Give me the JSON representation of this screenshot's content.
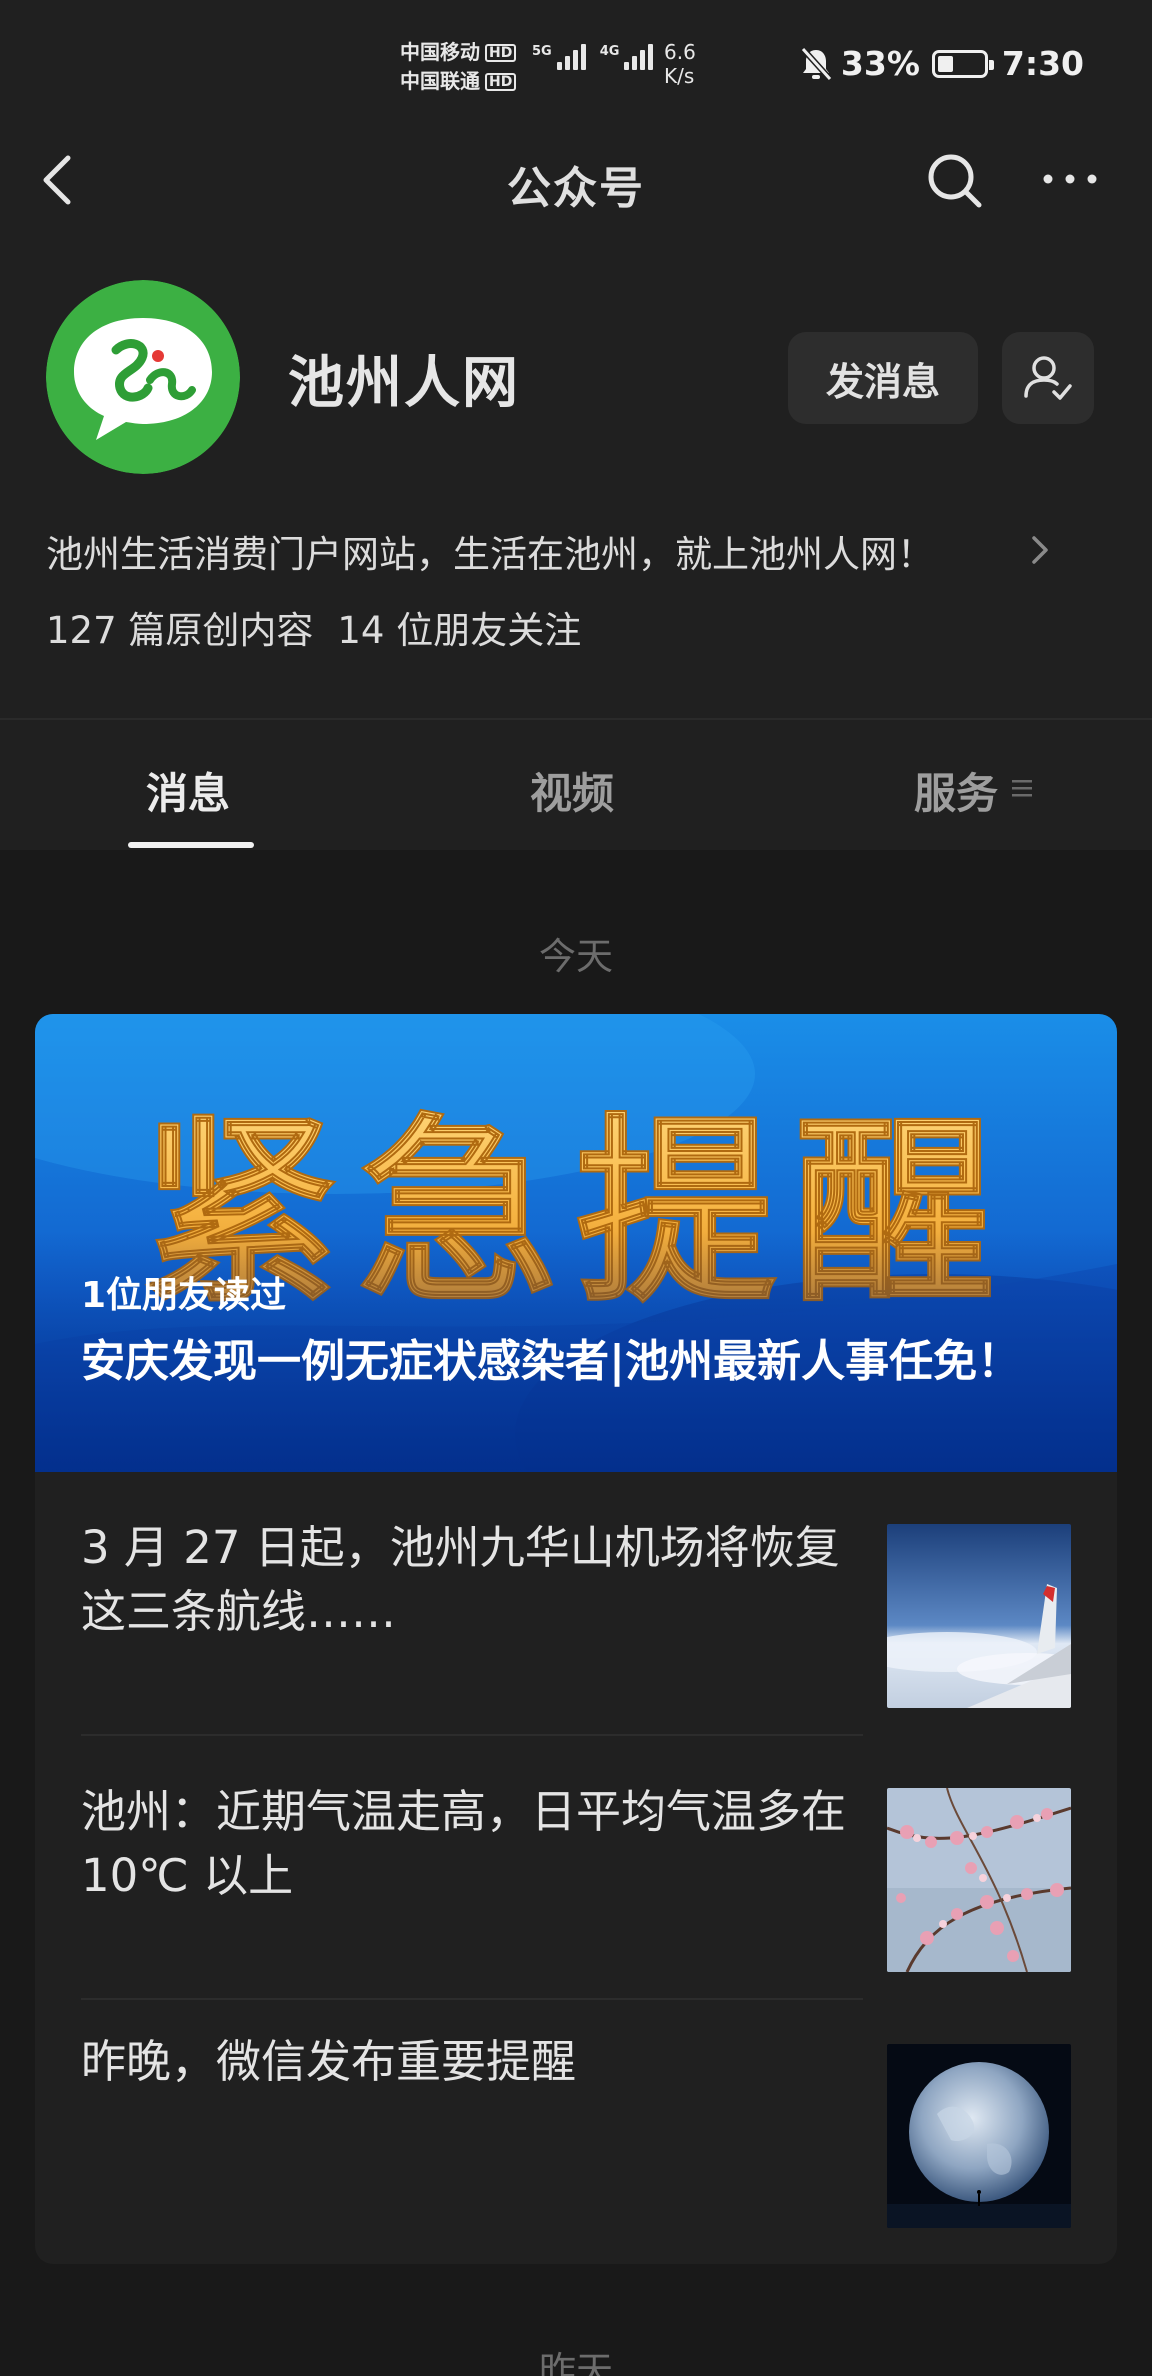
{
  "status_bar": {
    "carrier_1": "中国移动",
    "carrier_2": "中国联通",
    "hd_label": "HD",
    "signal_1_label": "5G",
    "signal_2_label": "4G",
    "speed_value": "6.6",
    "speed_unit": "K/s",
    "battery_percent": "33%",
    "battery_level": 0.33,
    "time": "7:30"
  },
  "nav": {
    "title": "公众号",
    "back_icon": "chevron-left-icon",
    "search_icon": "search-icon",
    "more_icon": "more-dots-icon"
  },
  "profile": {
    "name": "池州人网",
    "message_button": "发消息",
    "description": "池州生活消费门户网站，生活在池州，就上池州人网！",
    "original_count": "127 篇原创内容",
    "friends_following": "14 位朋友关注",
    "logo_color": "#3cb043"
  },
  "tabs": [
    {
      "label": "消息",
      "active": true
    },
    {
      "label": "视频",
      "active": false
    },
    {
      "label": "服务",
      "active": false
    }
  ],
  "messages": {
    "today_label": "今天",
    "yesterday_label": "昨天",
    "banner": {
      "image_text": "紧急提醒",
      "readers": "1位朋友读过",
      "title": "安庆发现一例无症状感染者|池州最新人事任免！"
    },
    "items": [
      {
        "title": "3 月 27 日起，池州九华山机场将恢复这三条航线……",
        "thumb": "airplane-wing-image"
      },
      {
        "title": "池州：近期气温走高，日平均气温多在 10℃ 以上",
        "thumb": "plum-blossom-image"
      },
      {
        "title": "昨晚，微信发布重要提醒",
        "thumb": "earth-image"
      }
    ]
  }
}
